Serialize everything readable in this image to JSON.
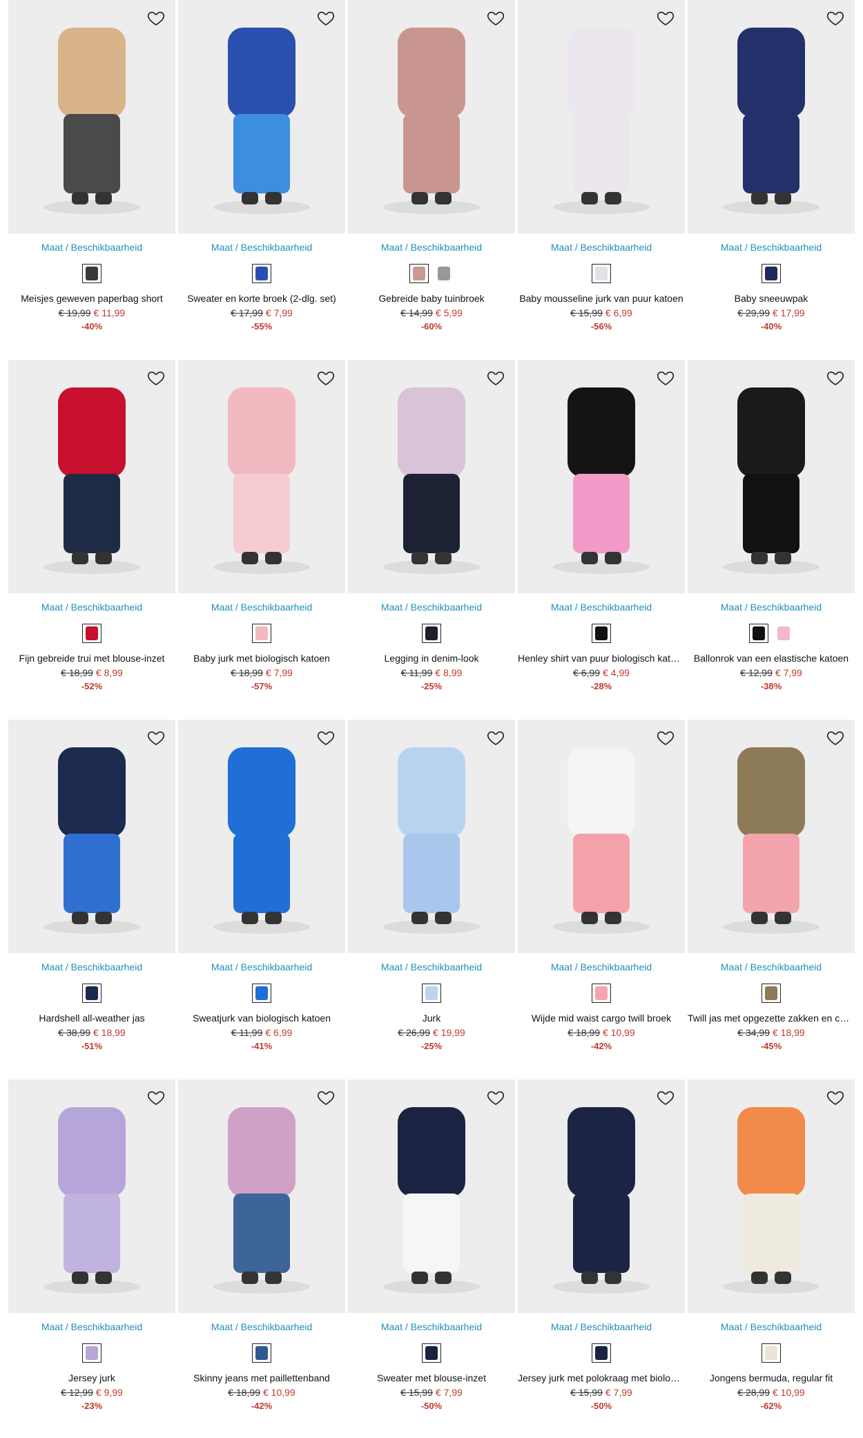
{
  "size_link_label": "Maat / Beschikbaarheid",
  "colors": {
    "link": "#1f8fb8",
    "sale": "#c0392b",
    "image_bg": "#ededed"
  },
  "icons": {
    "wishlist": "heart-outline-icon"
  },
  "products": [
    {
      "name": "Meisjes geweven paperbag short",
      "old_price": "€ 19,99",
      "new_price": "€ 11,99",
      "discount": "-40%",
      "swatches": [
        "#3a3a3a"
      ],
      "top": "#d9b48a",
      "bottom": "#4a4a4a"
    },
    {
      "name": "Sweater en korte broek (2-dlg. set)",
      "old_price": "€ 17,99",
      "new_price": "€ 7,99",
      "discount": "-55%",
      "swatches": [
        "#2a4fb0"
      ],
      "top": "#2b4fae",
      "bottom": "#3d8de0"
    },
    {
      "name": "Gebreide baby tuinbroek",
      "old_price": "€ 14,99",
      "new_price": "€ 5,99",
      "discount": "-60%",
      "swatches": [
        "#c79a93",
        "#9a9a95"
      ],
      "top": "#c9968f",
      "bottom": "#c9968f"
    },
    {
      "name": "Baby mousseline jurk van puur katoen",
      "old_price": "€ 15,99",
      "new_price": "€ 6,99",
      "discount": "-56%",
      "swatches": [
        "#e6e0e8"
      ],
      "top": "#ece6ee",
      "bottom": "#ece6ee"
    },
    {
      "name": "Baby sneeuwpak",
      "old_price": "€ 29,99",
      "new_price": "€ 17,99",
      "discount": "-40%",
      "swatches": [
        "#1f2a5a"
      ],
      "top": "#23306a",
      "bottom": "#23306a"
    },
    {
      "name": "Fijn gebreide trui met blouse-inzet",
      "old_price": "€ 18,99",
      "new_price": "€ 8,99",
      "discount": "-52%",
      "swatches": [
        "#c8102e"
      ],
      "top": "#c8102e",
      "bottom": "#1f2a44"
    },
    {
      "name": "Baby jurk met biologisch katoen",
      "old_price": "€ 18,99",
      "new_price": "€ 7,99",
      "discount": "-57%",
      "swatches": [
        "#f2b8c0"
      ],
      "top": "#f3b9c1",
      "bottom": "#f6cbd1"
    },
    {
      "name": "Legging in denim-look",
      "old_price": "€ 11,99",
      "new_price": "€ 8,99",
      "discount": "-25%",
      "swatches": [
        "#1b1f2e"
      ],
      "top": "#d9c3d8",
      "bottom": "#1c2133"
    },
    {
      "name": "Henley shirt van puur biologisch katoen",
      "old_price": "€ 6,99",
      "new_price": "€ 4,99",
      "discount": "-28%",
      "swatches": [
        "#111111"
      ],
      "top": "#141414",
      "bottom": "#f29ac8"
    },
    {
      "name": "Ballonrok van een elastische katoen",
      "old_price": "€ 12,99",
      "new_price": "€ 7,99",
      "discount": "-38%",
      "swatches": [
        "#111111",
        "#f4b6d0"
      ],
      "top": "#1a1a1a",
      "bottom": "#111111"
    },
    {
      "name": "Hardshell all-weather jas",
      "old_price": "€ 38,99",
      "new_price": "€ 18,99",
      "discount": "-51%",
      "swatches": [
        "#1b2a4e"
      ],
      "top": "#1b2a4e",
      "bottom": "#2f6fd0"
    },
    {
      "name": "Sweatjurk van biologisch katoen",
      "old_price": "€ 11,99",
      "new_price": "€ 6,99",
      "discount": "-41%",
      "swatches": [
        "#1f6fd6"
      ],
      "top": "#1f6fd6",
      "bottom": "#1f6fd6"
    },
    {
      "name": "Jurk",
      "old_price": "€ 26,99",
      "new_price": "€ 19,99",
      "discount": "-25%",
      "swatches": [
        "#bcd4ef"
      ],
      "top": "#b9d2f0",
      "bottom": "#a9c6ec"
    },
    {
      "name": "Wijde mid waist cargo twill broek",
      "old_price": "€ 18,99",
      "new_price": "€ 10,99",
      "discount": "-42%",
      "swatches": [
        "#f4a6ad"
      ],
      "top": "#f5f5f5",
      "bottom": "#f4a1a9"
    },
    {
      "name": "Twill jas met opgezette zakken en capuchon",
      "old_price": "€ 34,99",
      "new_price": "€ 18,99",
      "discount": "-45%",
      "swatches": [
        "#8c7a55"
      ],
      "top": "#8d7b57",
      "bottom": "#f2a3ac"
    },
    {
      "name": "Jersey jurk",
      "old_price": "€ 12,99",
      "new_price": "€ 9,99",
      "discount": "-23%",
      "swatches": [
        "#b7a6d8"
      ],
      "top": "#b6a5d9",
      "bottom": "#c1b3e0"
    },
    {
      "name": "Skinny jeans met paillettenband",
      "old_price": "€ 18,99",
      "new_price": "€ 10,99",
      "discount": "-42%",
      "swatches": [
        "#2f5a8f"
      ],
      "top": "#cfa1c6",
      "bottom": "#3d6597"
    },
    {
      "name": "Sweater met blouse-inzet",
      "old_price": "€ 15,99",
      "new_price": "€ 7,99",
      "discount": "-50%",
      "swatches": [
        "#1a2240"
      ],
      "top": "#1b2342",
      "bottom": "#f6f6f6"
    },
    {
      "name": "Jersey jurk met polokraag met biologisch katoen",
      "old_price": "€ 15,99",
      "new_price": "€ 7,99",
      "discount": "-50%",
      "swatches": [
        "#1b2342"
      ],
      "top": "#1c2446",
      "bottom": "#1c2446"
    },
    {
      "name": "Jongens bermuda, regular fit",
      "old_price": "€ 28,99",
      "new_price": "€ 10,99",
      "discount": "-62%",
      "swatches": [
        "#e9e4d6"
      ],
      "top": "#f28a4a",
      "bottom": "#efeade"
    }
  ]
}
